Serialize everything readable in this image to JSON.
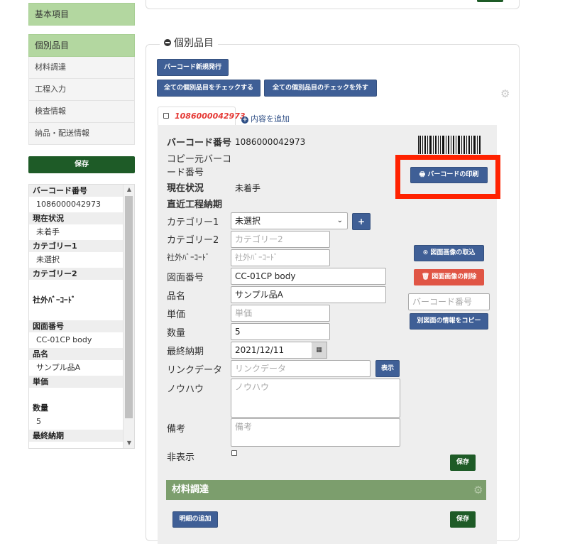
{
  "nav": {
    "basic": "基本項目",
    "individual": "個別品目",
    "items": [
      "材料調達",
      "工程入力",
      "検査情報",
      "納品・配送情報"
    ],
    "save": "保存"
  },
  "side_list": [
    {
      "label": "バーコード番号",
      "value": "1086000042973"
    },
    {
      "label": "現在状況",
      "value": "未着手"
    },
    {
      "label": "カテゴリー1",
      "value": "未選択"
    },
    {
      "label": "カテゴリー2",
      "value": ""
    },
    {
      "label": "社外ﾊﾞｰｺｰﾄﾞ",
      "value": ""
    },
    {
      "label": "図面番号",
      "value": "CC-01CP body"
    },
    {
      "label": "品名",
      "value": "サンプル品A"
    },
    {
      "label": "単価",
      "value": ""
    },
    {
      "label": "数量",
      "value": "5"
    },
    {
      "label": "最終納期",
      "value": ""
    }
  ],
  "panel": {
    "legend": "個別品目",
    "btn_new_barcode": "バーコード新規発行",
    "btn_check_all": "全ての個別品目をチェックする",
    "btn_uncheck_all": "全ての個別品目のチェックを外す",
    "tab_number": "1086000042973",
    "add_content": "内容を追加"
  },
  "form": {
    "barcode_label": "バーコード番号",
    "barcode_value": "1086000042973",
    "copy_source_label_1": "コピー元バーコ",
    "copy_source_label_2": "ード番号",
    "status_label": "現在状況",
    "status_value": "未着手",
    "recent_due_label": "直近工程納期",
    "category1_label": "カテゴリー1",
    "category1_value": "未選択",
    "category2_label": "カテゴリー2",
    "category2_placeholder": "カテゴリー2",
    "external_barcode_label": "社外ﾊﾞｰｺｰﾄﾞ",
    "external_barcode_placeholder": "社外ﾊﾞｰｺｰﾄﾞ",
    "drawing_label": "図面番号",
    "drawing_value": "CC-01CP body",
    "name_label": "品名",
    "name_value": "サンプル品A",
    "price_label": "単価",
    "price_placeholder": "単価",
    "qty_label": "数量",
    "qty_value": "5",
    "final_due_label": "最終納期",
    "final_due_value": "2021/12/11",
    "link_label": "リンクデータ",
    "link_placeholder": "リンクデータ",
    "show_btn": "表示",
    "knowhow_label": "ノウハウ",
    "knowhow_placeholder": "ノウハウ",
    "notes_label": "備考",
    "notes_placeholder": "備考",
    "hidden_label": "非表示",
    "save": "保存"
  },
  "right_col": {
    "print_barcode": "バーコードの印刷",
    "import_drawing": "図面画像の取込",
    "delete_drawing": "図面画像の削除",
    "barcode_input_placeholder": "バーコード番号",
    "copy_other": "別図面の情報をコピー"
  },
  "materials": {
    "title": "材料調達",
    "add_detail": "明細の追加",
    "save": "保存"
  },
  "colors": {
    "accent_green": "#1e5b27",
    "nav_green": "#b3d7a0",
    "button_blue": "#3f5f96",
    "danger_red": "#e05545",
    "highlight_red": "#ff2200",
    "section_green": "#7c9e6d"
  }
}
